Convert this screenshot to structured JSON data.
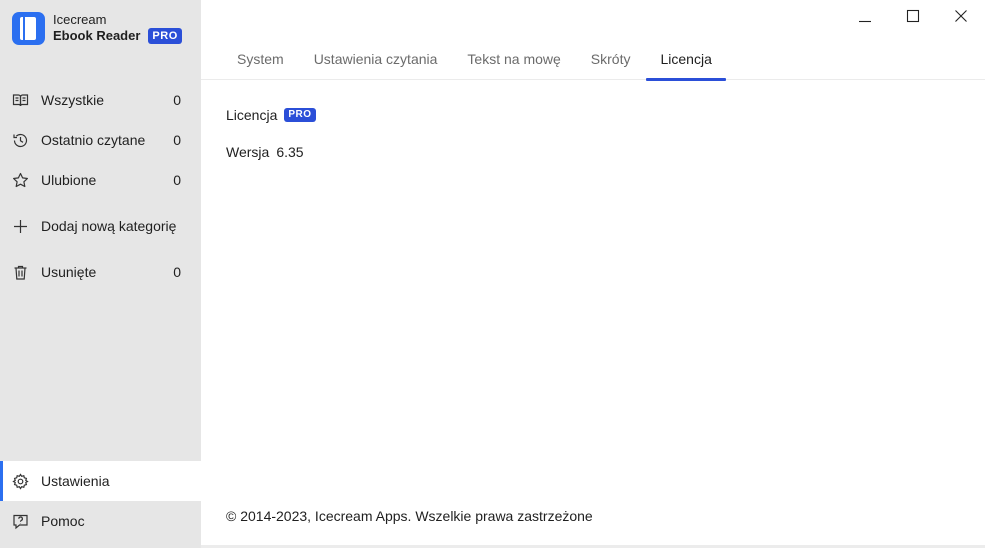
{
  "app": {
    "name_line1": "Icecream",
    "name_line2": "Ebook Reader",
    "badge": "PRO"
  },
  "sidebar": {
    "items": [
      {
        "label": "Wszystkie",
        "count": "0",
        "icon": "book-open-icon"
      },
      {
        "label": "Ostatnio czytane",
        "count": "0",
        "icon": "history-icon"
      },
      {
        "label": "Ulubione",
        "count": "0",
        "icon": "star-icon"
      },
      {
        "label": "Dodaj nową kategorię",
        "icon": "plus-icon"
      },
      {
        "label": "Usunięte",
        "count": "0",
        "icon": "trash-icon"
      }
    ],
    "bottom": [
      {
        "label": "Ustawienia",
        "icon": "gear-icon",
        "active": true
      },
      {
        "label": "Pomoc",
        "icon": "help-icon"
      }
    ]
  },
  "tabs": [
    {
      "label": "System"
    },
    {
      "label": "Ustawienia czytania"
    },
    {
      "label": "Tekst na mowę"
    },
    {
      "label": "Skróty"
    },
    {
      "label": "Licencja",
      "active": true
    }
  ],
  "license": {
    "label": "Licencja",
    "badge": "PRO",
    "version_label": "Wersja",
    "version_value": "6.35"
  },
  "footer": {
    "copyright": "© 2014-2023, Icecream Apps. Wszelkie prawa zastrzeżone"
  },
  "colors": {
    "accent": "#2b4fd8",
    "logo": "#2b6ff0",
    "sidebar_bg": "#e6e6e6"
  }
}
